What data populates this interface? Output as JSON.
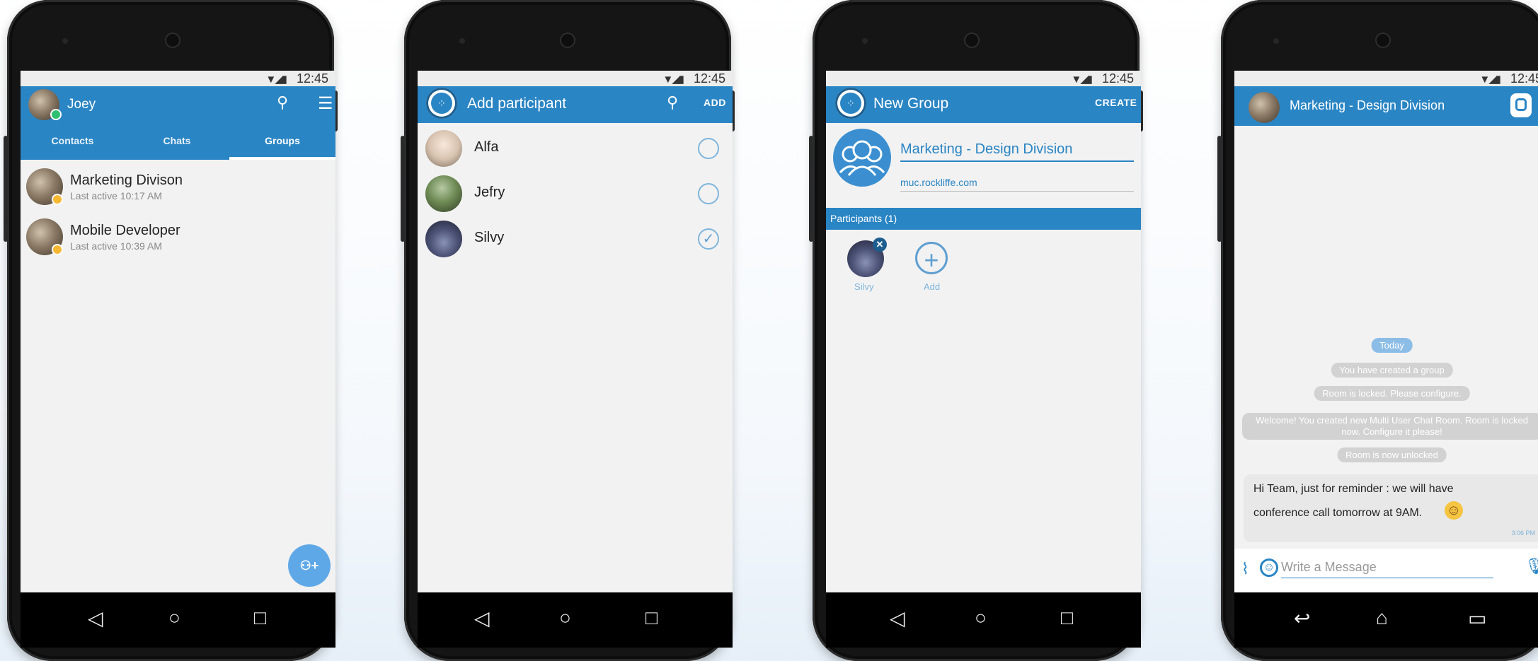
{
  "colors": {
    "primary": "#2a85c4",
    "background": "#f2f2f2",
    "fab": "#5fa8e8",
    "online": "#2fbf71",
    "away": "#f6b733"
  },
  "status_bar": {
    "time": "12:45",
    "signal_icon": "wifi-signal-battery-icons"
  },
  "nav_icons": [
    "back-triangle-icon",
    "home-circle-icon",
    "recents-square-icon"
  ],
  "screen1": {
    "user_name": "Joey",
    "icons": [
      "search-icon",
      "menu-icon"
    ],
    "tabs": [
      {
        "label": "Contacts"
      },
      {
        "label": "Chats"
      },
      {
        "label": "Groups",
        "active": true
      }
    ],
    "groups": [
      {
        "name": "Marketing Divison",
        "status": "Last active 10:17 AM"
      },
      {
        "name": "Mobile Developer",
        "status": "Last active 10:39 AM"
      }
    ],
    "fab_label": "⚇+"
  },
  "screen2": {
    "title": "Add participant",
    "action": "ADD",
    "participants": [
      {
        "name": "Alfa",
        "selected": false
      },
      {
        "name": "Jefry",
        "selected": false
      },
      {
        "name": "Silvy",
        "selected": true
      }
    ]
  },
  "screen3": {
    "title": "New Group",
    "action": "CREATE",
    "group_name": "Marketing - Design Division",
    "server": "muc.rockliffe.com",
    "participants_header": "Participants (1)",
    "member": "Silvy",
    "add_label": "Add"
  },
  "screen4": {
    "title": "Marketing - Design Division",
    "day": "Today",
    "system_messages": [
      "You have created a group",
      "Room is locked. Please configure.",
      "Welcome! You created new Multi User Chat Room. Room is locked now. Configure it please!",
      "Room is now unlocked"
    ],
    "message": {
      "line1": "Hi Team, just for reminder : we will have",
      "line2": "conference call tomorrow at 9AM.",
      "emoji": "☺",
      "time": "3:06 PM"
    },
    "input_placeholder": "Write a Message"
  }
}
